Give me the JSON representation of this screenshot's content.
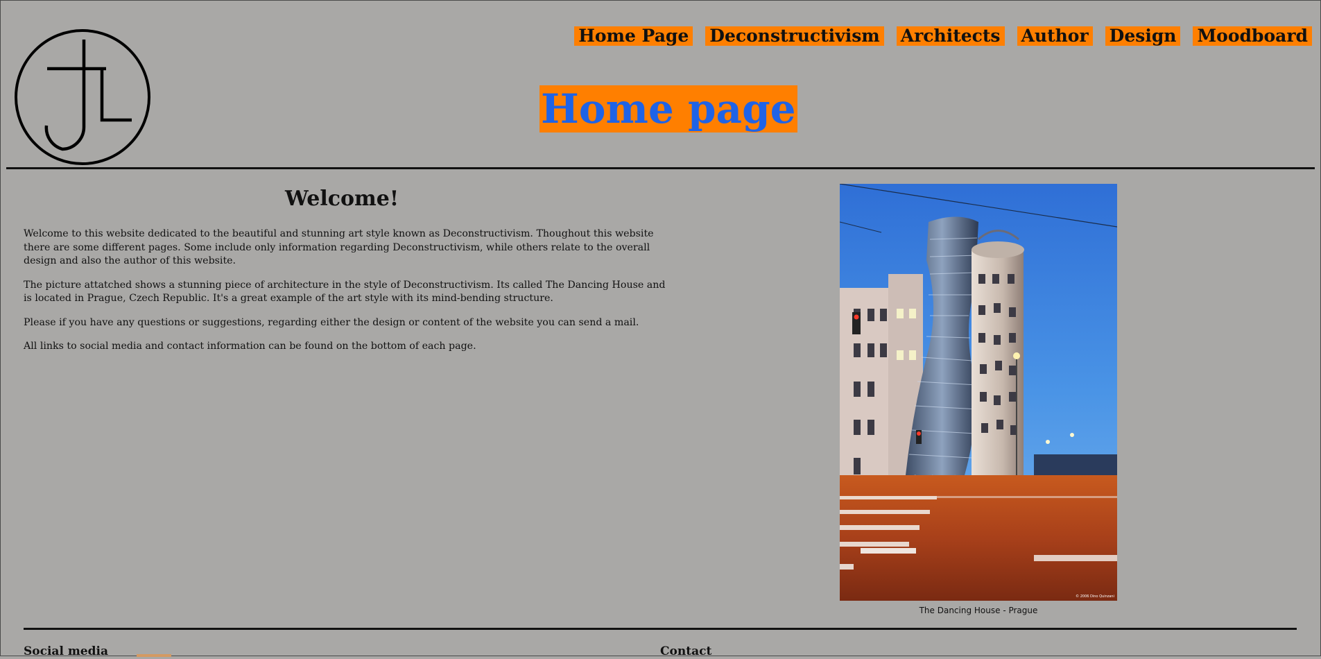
{
  "nav": {
    "items": [
      {
        "label": "Home Page"
      },
      {
        "label": "Deconstructivism"
      },
      {
        "label": "Architects"
      },
      {
        "label": "Author"
      },
      {
        "label": "Design"
      },
      {
        "label": "Moodboard"
      }
    ]
  },
  "header": {
    "title": "Home page",
    "logo_icon": "jl-monogram-circle-icon"
  },
  "main": {
    "heading": "Welcome!",
    "paragraphs": [
      "Welcome to this website dedicated to the beautiful and stunning art style known as Deconstructivism. Thoughout this website there are some different pages. Some include only information regarding Deconstructivism, while others relate to the overall design and also the author of this website.",
      "The picture attatched shows a stunning piece of architecture in the style of Deconstructivism. Its called The Dancing House and is located in Prague, Czech Republic. It's a great example of the art style with its mind-bending structure.",
      "Please if you have any questions or suggestions, regarding either the design or content of the website you can send a mail.",
      "All links to social media and contact information can be found on the bottom of each page."
    ],
    "image_caption": "The Dancing House - Prague",
    "image_credit": "© 2006 Dino Quinzani"
  },
  "footer": {
    "social_heading": "Social media",
    "contact_heading": "Contact"
  },
  "colors": {
    "background": "#a9a8a6",
    "accent": "#ff7f00",
    "title_text": "#1f63e6"
  }
}
